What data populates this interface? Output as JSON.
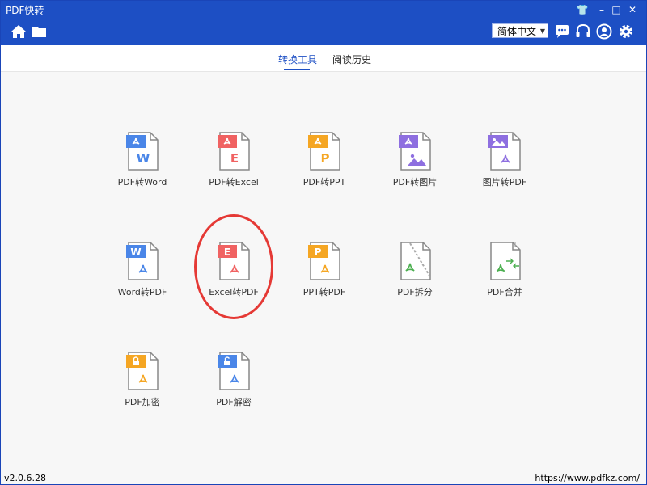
{
  "app": {
    "title": "PDF快转"
  },
  "window_controls": {
    "skin": "👕",
    "minimize": "–",
    "maximize": "□",
    "close": "✕"
  },
  "toolbar": {
    "language": "简体中文"
  },
  "tabs": [
    {
      "label": "转换工具"
    },
    {
      "label": "阅读历史"
    }
  ],
  "tools": [
    {
      "label": "PDF转Word",
      "badge": "W",
      "badge_color": "#4a86e8"
    },
    {
      "label": "PDF转Excel",
      "badge": "E",
      "badge_color": "#f06262"
    },
    {
      "label": "PDF转PPT",
      "badge": "P",
      "badge_color": "#f5a623"
    },
    {
      "label": "PDF转图片",
      "badge": "",
      "badge_color": "#8e6fe0"
    },
    {
      "label": "图片转PDF",
      "badge": "",
      "badge_color": "#8e6fe0"
    },
    {
      "label": "Word转PDF",
      "badge": "W",
      "badge_color": "#4a86e8"
    },
    {
      "label": "Excel转PDF",
      "badge": "E",
      "badge_color": "#f06262"
    },
    {
      "label": "PPT转PDF",
      "badge": "P",
      "badge_color": "#f5a623"
    },
    {
      "label": "PDF拆分",
      "badge": "",
      "badge_color": "#4caf50"
    },
    {
      "label": "PDF合并",
      "badge": "",
      "badge_color": "#4caf50"
    },
    {
      "label": "PDF加密",
      "badge": "",
      "badge_color": "#f5a623"
    },
    {
      "label": "PDF解密",
      "badge": "",
      "badge_color": "#4a86e8"
    }
  ],
  "status": {
    "version": "v2.0.6.28",
    "url": "https://www.pdfkz.com/"
  }
}
